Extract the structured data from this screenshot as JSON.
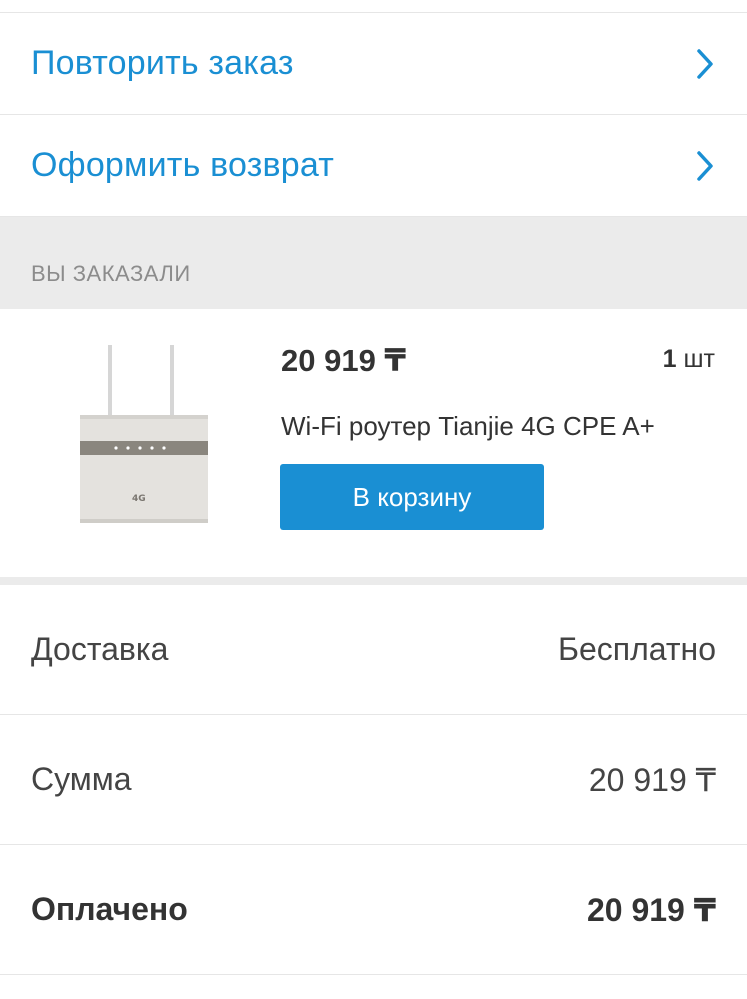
{
  "actions": [
    {
      "label": "Повторить заказ",
      "icon": "chevron-right-icon"
    },
    {
      "label": "Оформить возврат",
      "icon": "chevron-right-icon"
    }
  ],
  "ordered_section": {
    "header": "ВЫ ЗАКАЗАЛИ"
  },
  "product": {
    "image_icon": "router-image",
    "image_badge": "4G",
    "price": "20 919 ₸",
    "qty_number": "1",
    "qty_unit": "шт",
    "name": "Wi-Fi роутер Tianjie 4G CPE A+",
    "cart_button": "В корзину"
  },
  "summary": {
    "delivery_label": "Доставка",
    "delivery_value": "Бесплатно",
    "sum_label": "Сумма",
    "sum_value": "20 919 ₸",
    "paid_label": "Оплачено",
    "paid_value": "20 919 ₸"
  },
  "colors": {
    "accent": "#1a8fd3",
    "section_bg": "#ebebeb",
    "text": "#333333",
    "muted": "#8c8c8c"
  }
}
